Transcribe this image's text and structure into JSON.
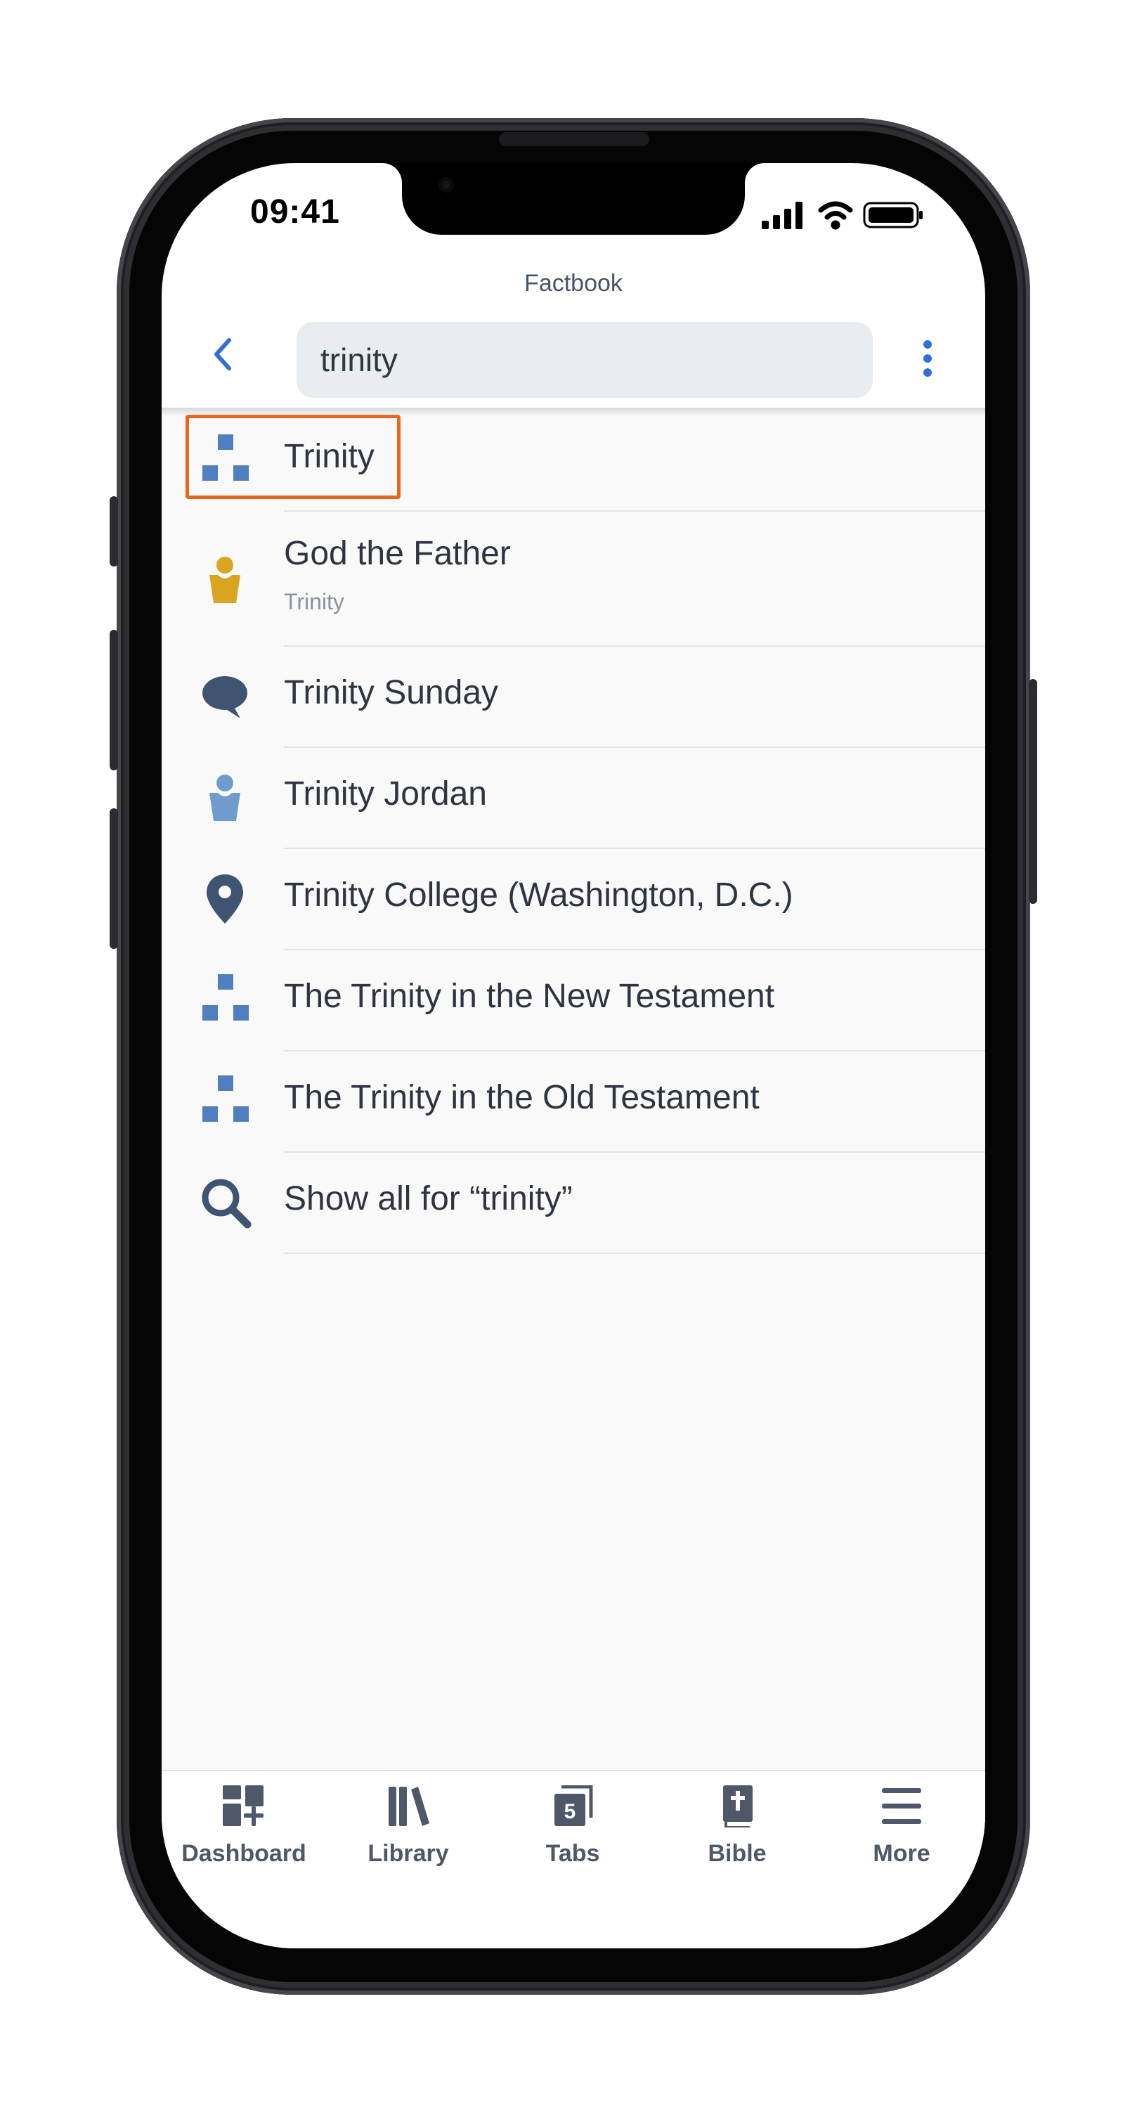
{
  "status_bar": {
    "time": "09:41"
  },
  "header": {
    "title": "Factbook",
    "search_value": "trinity"
  },
  "results": [
    {
      "title": "Trinity",
      "subtitle": "",
      "icon": "topic-blocks-icon",
      "highlighted": true
    },
    {
      "title": "God the Father",
      "subtitle": "Trinity",
      "icon": "person-gold-icon"
    },
    {
      "title": "Trinity Sunday",
      "subtitle": "",
      "icon": "speech-bubble-icon"
    },
    {
      "title": "Trinity Jordan",
      "subtitle": "",
      "icon": "person-blue-icon"
    },
    {
      "title": "Trinity College (Washington, D.C.)",
      "subtitle": "",
      "icon": "location-pin-icon"
    },
    {
      "title": "The Trinity in the New Testament",
      "subtitle": "",
      "icon": "topic-blocks-icon"
    },
    {
      "title": "The Trinity in the Old Testament",
      "subtitle": "",
      "icon": "topic-blocks-icon"
    },
    {
      "title": "Show all for “trinity”",
      "subtitle": "",
      "icon": "search-icon"
    }
  ],
  "tabbar": [
    {
      "label": "Dashboard",
      "icon": "dashboard-icon"
    },
    {
      "label": "Library",
      "icon": "library-icon"
    },
    {
      "label": "Tabs",
      "icon": "tabs-icon",
      "badge": "5"
    },
    {
      "label": "Bible",
      "icon": "bible-icon"
    },
    {
      "label": "More",
      "icon": "hamburger-menu-icon"
    }
  ],
  "colors": {
    "accent_blue": "#2f6fd6",
    "icon_blue": "#4f7fbf",
    "icon_gold": "#d9a520",
    "icon_slate": "#3f5470",
    "highlight_orange": "#e8651c"
  }
}
